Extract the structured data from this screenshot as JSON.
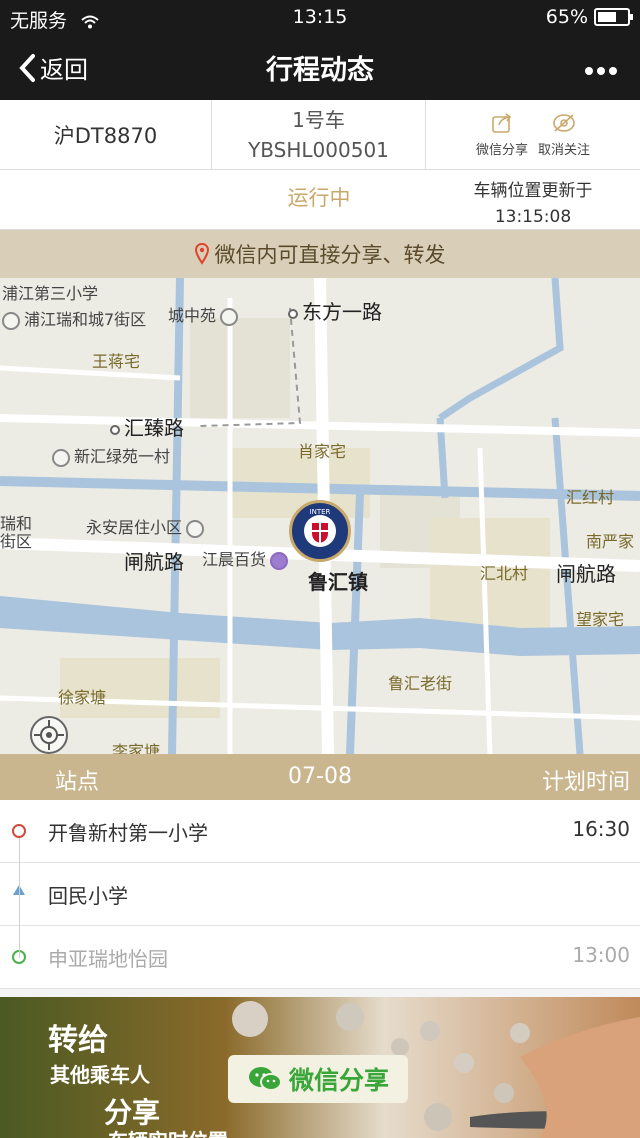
{
  "status_bar": {
    "carrier": "无服务",
    "time": "13:15",
    "battery": "65%",
    "battery_level": 0.65
  },
  "nav": {
    "back_label": "返回",
    "title": "行程动态"
  },
  "vehicle": {
    "plate": "沪DT8870",
    "car_name": "1号车",
    "car_id": "YBSHL000501",
    "share_label": "微信分享",
    "unfollow_label": "取消关注"
  },
  "status": {
    "running": "运行中",
    "updated_label": "车辆位置更新于",
    "updated_time": "13:15:08"
  },
  "share_banner": "微信内可直接分享、转发",
  "map": {
    "labels": {
      "l1": "浦江第三小学",
      "l2": "浦江瑞和城7街区",
      "l3": "城中苑",
      "l4": "东方一路",
      "l5": "王蒋宅",
      "l6": "汇臻路",
      "l7": "新汇绿苑一村",
      "l8": "肖家宅",
      "l9": "汇红村",
      "l10": "瑞和",
      "l11": "街区",
      "l12": "永安居住小区",
      "l13": "南严家",
      "l14": "闸航路",
      "l15": "江晨百货",
      "l16": "鲁汇镇",
      "l17": "汇北村",
      "l18": "闸航路",
      "l19": "望家宅",
      "l20": "徐家塘",
      "l21": "鲁汇老街",
      "l22": "李家塘"
    }
  },
  "table_head": {
    "col1": "站点",
    "col2": "07-08",
    "col3": "计划时间"
  },
  "stops": [
    {
      "name": "开鲁新村第一小学",
      "time": "16:30"
    },
    {
      "name": "回民小学",
      "time": ""
    },
    {
      "name": "申亚瑞地怡园",
      "time": "13:00"
    }
  ],
  "ad": {
    "line1": "转给",
    "line2": "其他乘车人",
    "line3": "分享",
    "line4": "车辆实时位置",
    "button": "微信分享"
  },
  "colors": {
    "accent": "#c9a96b",
    "header": "#1a1a1a",
    "wechat_green": "#3aa63a"
  }
}
